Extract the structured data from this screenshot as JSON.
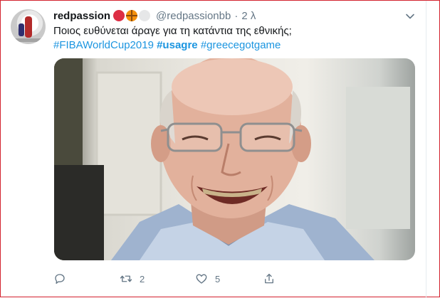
{
  "tweet": {
    "display_name": "redpassion",
    "name_emojis": [
      "red-circle-emoji",
      "basketball-emoji",
      "white-circle-emoji"
    ],
    "handle": "@redpassionbb",
    "separator": "·",
    "time": "2 λ",
    "text": "Ποιος ευθύνεται άραγε για τη κατάντια της εθνικής;",
    "hashtags": [
      {
        "text": "#FIBAWorldCup2019",
        "bold": false
      },
      {
        "text": "#usagre",
        "bold": true
      },
      {
        "text": "#greecegotgame",
        "bold": false
      }
    ],
    "media": {
      "icon": "photo-of-smiling-man-with-glasses"
    },
    "actions": {
      "reply_count": "",
      "retweet_count": "2",
      "like_count": "5"
    }
  },
  "icons": {
    "caret": "chevron-down-icon",
    "reply": "reply-icon",
    "retweet": "retweet-icon",
    "like": "heart-icon",
    "share": "share-icon"
  },
  "colors": {
    "link": "#1b95e0",
    "secondary_text": "#657786",
    "frame_border": "#d3232f"
  }
}
